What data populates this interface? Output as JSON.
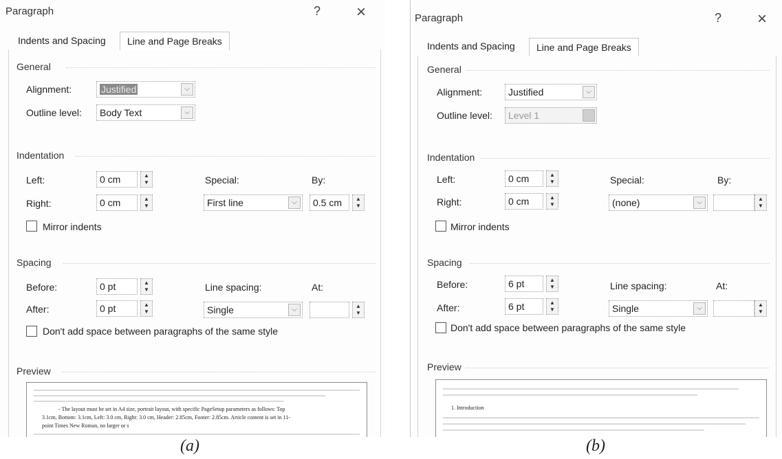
{
  "dialog_a": {
    "title": "Paragraph",
    "help": "?",
    "close": "×",
    "tabs": [
      "Indents and Spacing",
      "Line and Page Breaks"
    ],
    "general": {
      "label": "General",
      "alignment_label": "Alignment:",
      "alignment_value": "Justified",
      "outline_label": "Outline level:",
      "outline_value": "Body Text"
    },
    "indentation": {
      "label": "Indentation",
      "left_label": "Left:",
      "left_value": "0 cm",
      "right_label": "Right:",
      "right_value": "0 cm",
      "special_label": "Special:",
      "special_value": "First line",
      "by_label": "By:",
      "by_value": "0.5 cm",
      "mirror_label": "Mirror indents"
    },
    "spacing": {
      "label": "Spacing",
      "before_label": "Before:",
      "before_value": "0 pt",
      "after_label": "After:",
      "after_value": "0 pt",
      "line_spacing_label": "Line spacing:",
      "line_spacing_value": "Single",
      "at_label": "At:",
      "at_value": "",
      "dont_add_label": "Don't add space between paragraphs of the same style"
    },
    "preview": {
      "label": "Preview",
      "text1": "- The layout must be set in A4 size, portrait layout, with specific PageSetup parameters as follows: Top",
      "text2": "3.1cm, Bottom: 3.1cm, Left: 3.0 cm, Right: 3.0 cm, Header: 2.85cm, Footer: 2.85cm. Article content is set in 11-",
      "text3": "point Times New Roman, no larger or s"
    }
  },
  "dialog_b": {
    "title": "Paragraph",
    "help": "?",
    "close": "×",
    "tabs": [
      "Indents and Spacing",
      "Line and Page Breaks"
    ],
    "general": {
      "label": "General",
      "alignment_label": "Alignment:",
      "alignment_value": "Justified",
      "outline_label": "Outline level:",
      "outline_value": "Level 1"
    },
    "indentation": {
      "label": "Indentation",
      "left_label": "Left:",
      "left_value": "0 cm",
      "right_label": "Right:",
      "right_value": "0 cm",
      "special_label": "Special:",
      "special_value": "(none)",
      "by_label": "By:",
      "by_value": "",
      "mirror_label": "Mirror indents"
    },
    "spacing": {
      "label": "Spacing",
      "before_label": "Before:",
      "before_value": "6 pt",
      "after_label": "After:",
      "after_value": "6 pt",
      "line_spacing_label": "Line spacing:",
      "line_spacing_value": "Single",
      "at_label": "At:",
      "at_value": "",
      "dont_add_label": "Don't add space between paragraphs of the same style"
    },
    "preview": {
      "label": "Preview",
      "text1": "1. Introduction"
    }
  },
  "captions": {
    "a": "(a)",
    "b": "(b)"
  }
}
